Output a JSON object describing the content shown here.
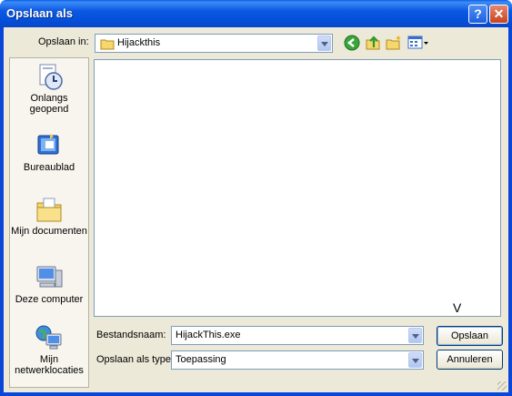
{
  "window": {
    "title": "Opslaan als"
  },
  "toolbar": {
    "save_in_label": "Opslaan in:",
    "folder": "Hijackthis"
  },
  "places": [
    {
      "label": "Onlangs geopend"
    },
    {
      "label": "Bureaublad"
    },
    {
      "label": "Mijn documenten"
    },
    {
      "label": "Deze computer"
    },
    {
      "label": "Mijn netwerklocaties"
    }
  ],
  "cursor_mark": "V",
  "form": {
    "filename_label": "Bestandsnaam:",
    "filename_value": "HijackThis.exe",
    "type_label": "Opslaan als type:",
    "type_value": "Toepassing",
    "save_button": "Opslaan",
    "cancel_button": "Annuleren"
  },
  "colors": {
    "titlebar": "#0a46d8",
    "face": "#ece9d8",
    "accent": "#003c74"
  }
}
